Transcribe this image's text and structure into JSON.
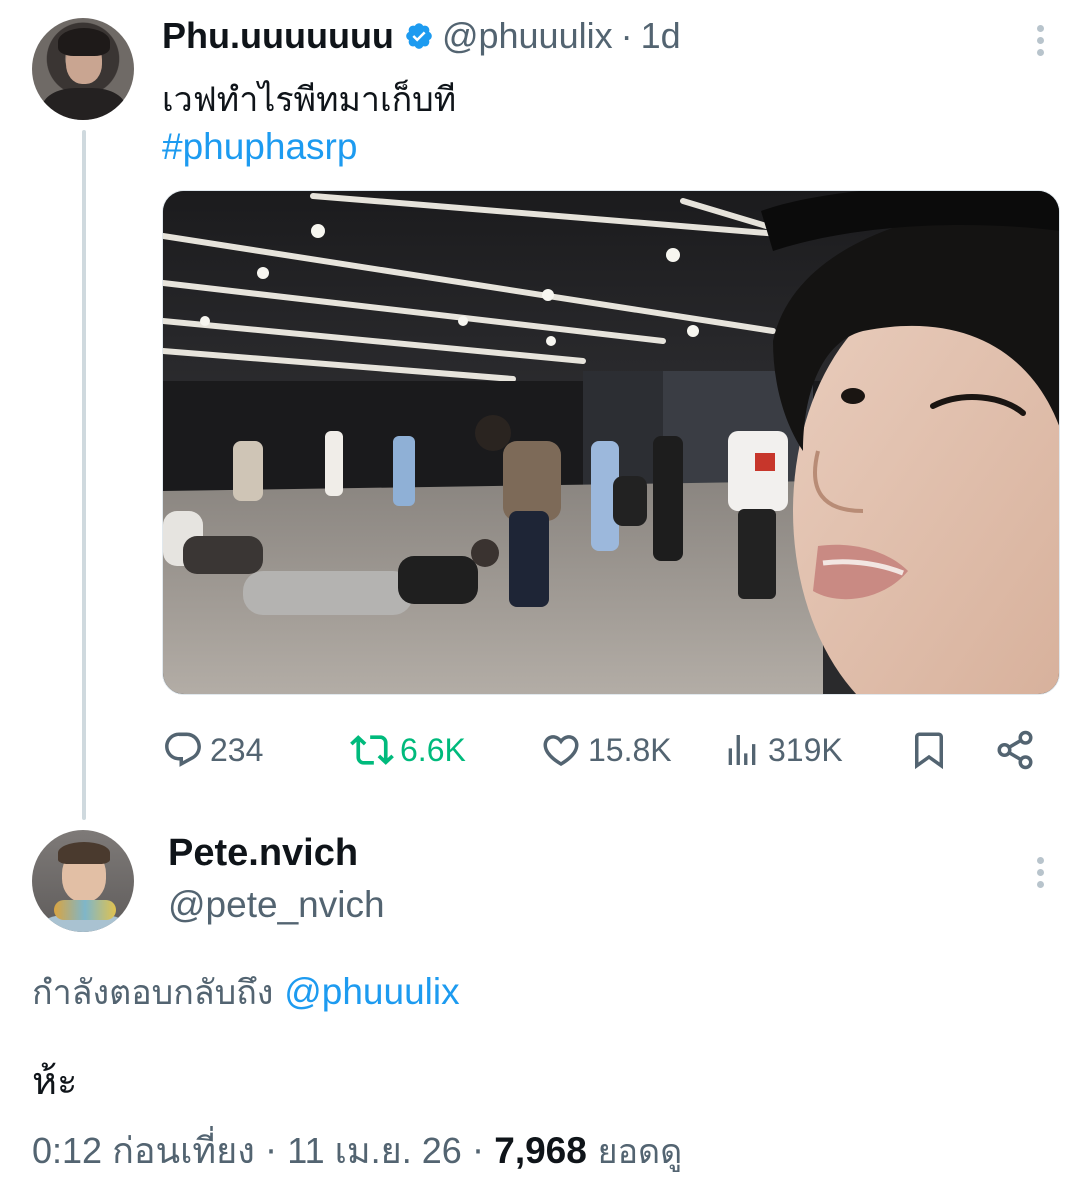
{
  "parent_tweet": {
    "display_name": "Phu.uuuuuuu",
    "handle": "@phuuulix",
    "separator": "·",
    "time": "1d",
    "text": "เวฟทำไรพีทมาเก็บที",
    "hashtag": "#phuphasrp",
    "stats": {
      "replies": "234",
      "retweets": "6.6K",
      "likes": "15.8K",
      "views": "319K"
    }
  },
  "reply_tweet": {
    "display_name": "Pete.nvich",
    "handle": "@pete_nvich",
    "replying_label": "กำลังตอบกลับถึง",
    "replying_to": "@phuuulix",
    "text": "ห้ะ",
    "time": "0:12 ก่อนเที่ยง",
    "separator": "·",
    "date": "11 เม.ย. 26",
    "views_count": "7,968",
    "views_label": "ยอดดู"
  },
  "colors": {
    "link": "#1d9bf0",
    "muted": "#536471",
    "retweet_active": "#00ba7c",
    "verified": "#1d9bf0",
    "thread_line": "#cfd9de"
  },
  "icons": {
    "verified": "verified-badge-icon",
    "more": "more-vertical-icon",
    "reply": "reply-bubble-icon",
    "retweet": "retweet-icon",
    "like": "heart-icon",
    "views": "bar-chart-icon",
    "bookmark": "bookmark-icon",
    "share": "share-icon"
  }
}
